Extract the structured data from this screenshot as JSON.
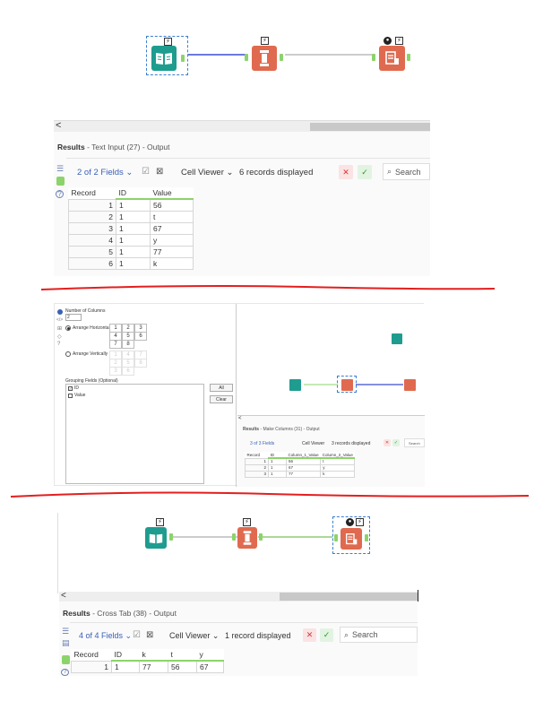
{
  "panel1": {
    "results_label": "Results",
    "results_rest": " - Text Input (27) - Output",
    "fields_selector": "2 of 2 Fields",
    "cell_viewer": "Cell Viewer",
    "records_displayed": "6 records displayed",
    "search_placeholder": "Search",
    "headers": [
      "Record",
      "ID",
      "Value"
    ],
    "rows": [
      [
        "1",
        "1",
        "56"
      ],
      [
        "2",
        "1",
        "t"
      ],
      [
        "3",
        "1",
        "67"
      ],
      [
        "4",
        "1",
        "y"
      ],
      [
        "5",
        "1",
        "77"
      ],
      [
        "6",
        "1",
        "k"
      ]
    ]
  },
  "panel2": {
    "config": {
      "number_of_columns_label": "Number of Columns",
      "number_of_columns_value": "2",
      "arrange_horizontally": "Arrange Horizontally",
      "arrange_vertically": "Arrange Vertically",
      "grid_h": [
        "1",
        "2",
        "3",
        "4",
        "5",
        "6",
        "7",
        "8"
      ],
      "grid_v": [
        "1",
        "4",
        "7",
        "2",
        "5",
        "8",
        "3",
        "6"
      ],
      "grouping_fields_label": "Grouping Fields (Optional)",
      "grouping_fields": [
        "ID",
        "Value"
      ],
      "all_button": "All",
      "clear_button": "Clear"
    },
    "results_label": "Results",
    "results_rest": " - Make Columns (31) - Output",
    "fields_selector": "3 of 3 Fields",
    "cell_viewer": "Cell Viewer",
    "records_displayed": "3 records displayed",
    "search_placeholder": "Search",
    "headers": [
      "Record",
      "ID",
      "Column_1_Value",
      "Column_2_Value"
    ],
    "rows": [
      [
        "1",
        "1",
        "56",
        "t"
      ],
      [
        "2",
        "1",
        "67",
        "y"
      ],
      [
        "3",
        "1",
        "77",
        "k"
      ]
    ]
  },
  "panel3": {
    "results_label": "Results",
    "results_rest": " - Cross Tab (38) - Output",
    "fields_selector": "4 of 4 Fields",
    "cell_viewer": "Cell Viewer",
    "records_displayed": "1 record displayed",
    "search_placeholder": "Search",
    "headers": [
      "Record",
      "ID",
      "k",
      "t",
      "y"
    ],
    "rows": [
      [
        "1",
        "1",
        "77",
        "56",
        "67"
      ]
    ]
  },
  "colors": {
    "text_input_tool": "#1e9c8f",
    "transform_tool": "#e06a4f",
    "browse_tool": "#e06a4f",
    "anchor_green": "#8cd36b",
    "connection_blue": "#3a4ed0",
    "connection_gray": "#999999",
    "divider_red": "#e41e1e",
    "accent_blue": "#3b61b5"
  },
  "icons": [
    "book-icon",
    "column-icon",
    "browse-icon",
    "lightning-icon",
    "chevron-left-icon",
    "list-icon",
    "table-icon",
    "help-icon",
    "check-icon",
    "close-icon",
    "search-icon",
    "chevron-down-icon"
  ]
}
